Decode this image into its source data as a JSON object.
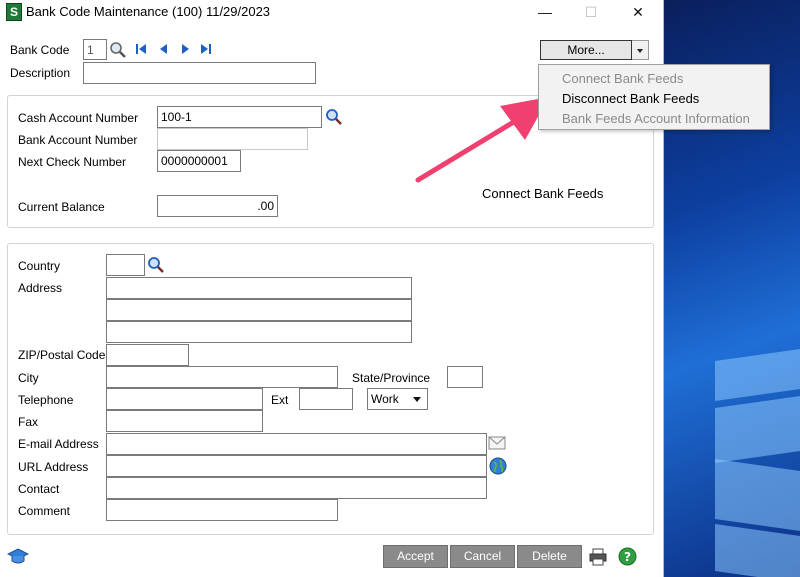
{
  "window": {
    "app_icon_letter": "S",
    "title": "Bank Code Maintenance (100) 11/29/2023",
    "minimize": "—",
    "maximize": "☐",
    "close": "✕"
  },
  "header": {
    "bank_code_label": "Bank Code",
    "bank_code_value": "1",
    "description_label": "Description",
    "description_value": "",
    "more_button_label": "More...",
    "more_menu": [
      {
        "label": "Connect Bank Feeds",
        "enabled": false
      },
      {
        "label": "Disconnect Bank Feeds",
        "enabled": true
      },
      {
        "label": "Bank Feeds Account Information",
        "enabled": false
      }
    ]
  },
  "account": {
    "cash_account_label": "Cash Account Number",
    "cash_account_value": "100-1",
    "bank_account_label": "Bank Account Number",
    "bank_account_value": "",
    "next_check_label": "Next Check Number",
    "next_check_value": "0000000001",
    "current_balance_label": "Current Balance",
    "current_balance_value": ".00"
  },
  "address": {
    "country_label": "Country",
    "address_label": "Address",
    "zip_label": "ZIP/Postal Code",
    "city_label": "City",
    "state_label": "State/Province",
    "telephone_label": "Telephone",
    "ext_label": "Ext",
    "phone_type_value": "Work",
    "fax_label": "Fax",
    "email_label": "E-mail Address",
    "url_label": "URL Address",
    "contact_label": "Contact",
    "comment_label": "Comment"
  },
  "callout_text": "Connect Bank Feeds",
  "footer": {
    "accept_label": "Accept",
    "cancel_label": "Cancel",
    "delete_label": "Delete"
  },
  "colors": {
    "arrow": "#f0406f",
    "button_gray": "#8a8a8a",
    "lookup_blue": "#1f5fbf"
  }
}
